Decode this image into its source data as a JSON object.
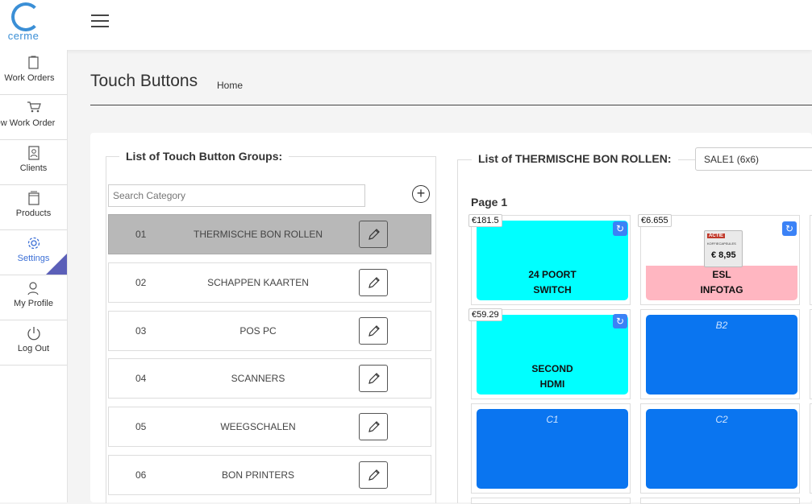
{
  "app": {
    "logo_text": "cerme"
  },
  "nav": [
    {
      "label": "Work Orders",
      "icon": "clipboard-icon"
    },
    {
      "label": "New Work Order",
      "icon": "cart-icon"
    },
    {
      "label": "Clients",
      "icon": "contact-icon"
    },
    {
      "label": "Products",
      "icon": "box-icon"
    },
    {
      "label": "Settings",
      "icon": "gear-icon"
    },
    {
      "label": "My Profile",
      "icon": "profile-icon"
    },
    {
      "label": "Log Out",
      "icon": "power-icon"
    }
  ],
  "page": {
    "title": "Touch Buttons",
    "breadcrumb": "Home"
  },
  "groups_panel": {
    "legend": "List of Touch Button Groups:",
    "search_placeholder": "Search Category",
    "add_label": "+",
    "groups": [
      {
        "num": "01",
        "name": "THERMISCHE BON ROLLEN"
      },
      {
        "num": "02",
        "name": "SCHAPPEN KAARTEN"
      },
      {
        "num": "03",
        "name": "POS PC"
      },
      {
        "num": "04",
        "name": "SCANNERS"
      },
      {
        "num": "05",
        "name": "WEEGSCHALEN"
      },
      {
        "num": "06",
        "name": "BON PRINTERS"
      }
    ],
    "selected_index": 0
  },
  "buttons_panel": {
    "legend": "List of THERMISCHE BON ROLLEN:",
    "layout_value": "SALE1 (6x6)",
    "page_label": "Page 1",
    "buttons": [
      {
        "price": "€181.5",
        "line1": "24 POORT",
        "line2": "SWITCH",
        "color": "#00ffff"
      },
      {
        "price": "€6.655",
        "line1": "ESL",
        "line2": "INFOTAG",
        "color": "#ffb6c1",
        "esl": {
          "tag": "ACTIE",
          "sub": "KOFFIECAPSULES",
          "amount": "€ 8,95"
        }
      },
      {
        "price": "€59.29",
        "line1": "SECOND",
        "line2": "HDMI",
        "color": "#00ffff"
      },
      {
        "code": "B2",
        "color": "#0a75f0"
      },
      {
        "code": "C1",
        "color": "#0a75f0"
      },
      {
        "code": "C2",
        "color": "#0a75f0"
      }
    ],
    "refresh_icon": "↻"
  },
  "colors": {
    "accent": "#3b6fd6",
    "brand": "#3b8fd6"
  }
}
